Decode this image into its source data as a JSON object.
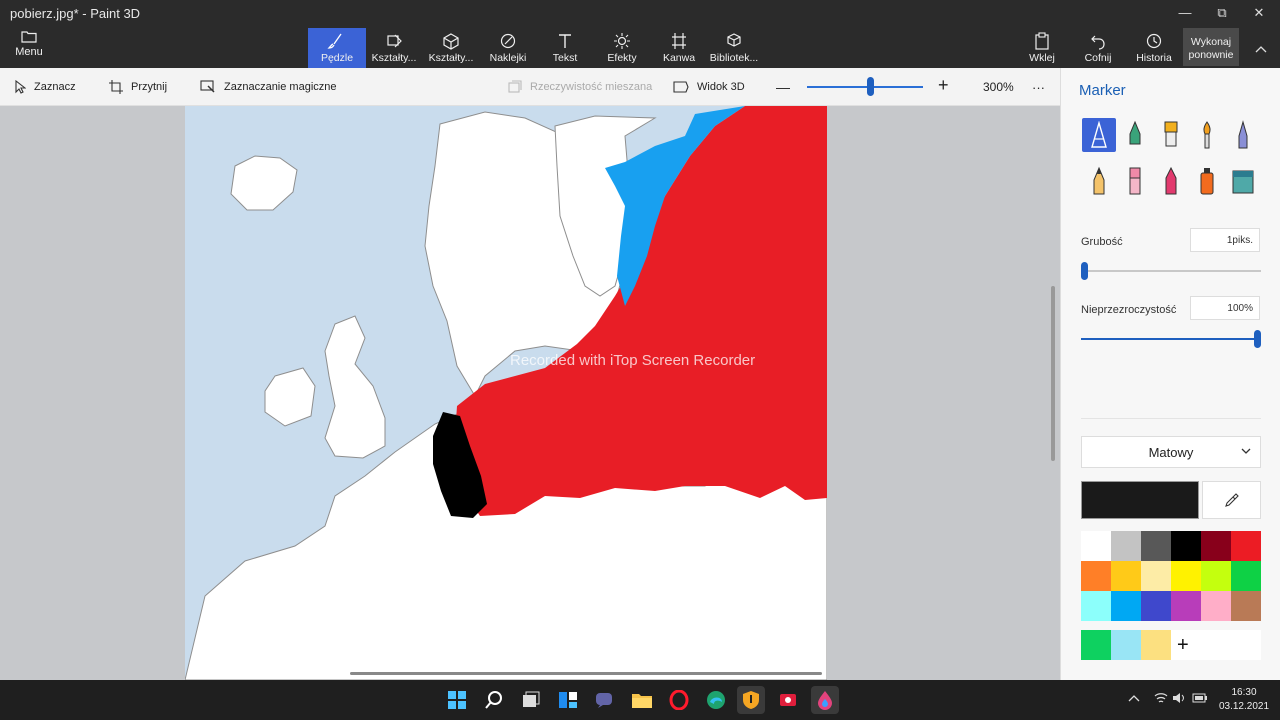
{
  "window": {
    "title": "pobierz.jpg* - Paint 3D",
    "minimize": "—",
    "maximize": "⧉",
    "close": "✕"
  },
  "menu": {
    "label": "Menu"
  },
  "ribbon": {
    "tabs": [
      {
        "label": "Pędzle"
      },
      {
        "label": "Kształty..."
      },
      {
        "label": "Kształty..."
      },
      {
        "label": "Naklejki"
      },
      {
        "label": "Tekst"
      },
      {
        "label": "Efekty"
      },
      {
        "label": "Kanwa"
      },
      {
        "label": "Bibliotek..."
      }
    ],
    "actions": {
      "paste": "Wklej",
      "undo": "Cofnij",
      "history": "Historia",
      "redo": "Wykonaj ponownie"
    }
  },
  "toolbar": {
    "select": "Zaznacz",
    "crop": "Przytnij",
    "magic_select": "Zaznaczanie magiczne",
    "mixed_reality": "Rzeczywistość mieszana",
    "view3d": "Widok 3D",
    "zoom_out": "—",
    "zoom_in": "+",
    "zoom": "300%",
    "more": "···"
  },
  "zoom_level_percent": 300,
  "canvas": {
    "watermark": "Recorded with iTop Screen Recorder"
  },
  "panel": {
    "title": "Marker",
    "thickness_label": "Grubość",
    "thickness_value": "1piks.",
    "opacity_label": "Nieprzezroczystość",
    "opacity_value": "100%",
    "finish": "Matowy",
    "add": "+"
  },
  "colors": {
    "current": "#1a1a1a",
    "palette": [
      "#ffffff",
      "#c3c3c3",
      "#585858",
      "#000000",
      "#88001b",
      "#ec1c24",
      "#ff7f27",
      "#ffca18",
      "#fdeca6",
      "#fff200",
      "#c4ff0e",
      "#0ed145",
      "#8cfffb",
      "#00a8f3",
      "#3f48cc",
      "#b83dba",
      "#ffaec8",
      "#b97a56"
    ],
    "custom": [
      "#0ed160",
      "#99e5f5",
      "#fce080"
    ],
    "accent": "#3b63d6",
    "map_red": "#e81e26",
    "map_blue": "#18a0f0"
  },
  "taskbar": {
    "time": "16:30",
    "date": "03.12.2021"
  }
}
